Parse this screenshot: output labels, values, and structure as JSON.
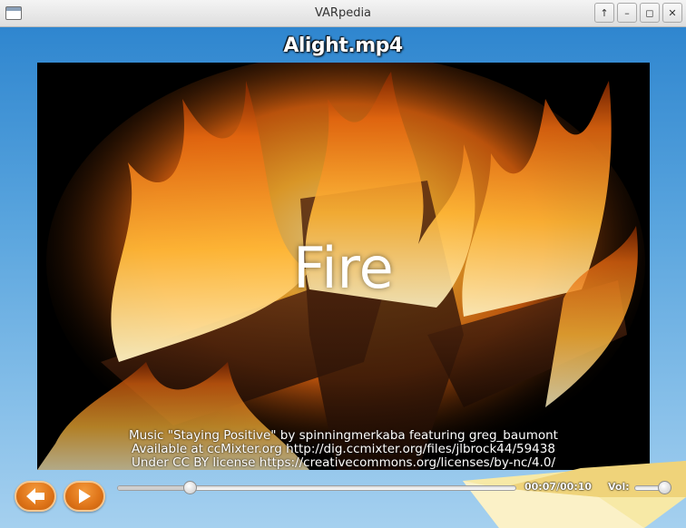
{
  "window": {
    "title": "VARpedia",
    "controls": [
      {
        "name": "maximize-icon",
        "glyph": "↑"
      },
      {
        "name": "minimize-icon",
        "glyph": "–"
      },
      {
        "name": "restore-icon",
        "glyph": "◻"
      },
      {
        "name": "close-icon",
        "glyph": "✕"
      }
    ]
  },
  "player": {
    "file_title": "Alight.mp4",
    "video_word": "Fire",
    "credits": [
      "Music \"Staying Positive\" by spinningmerkaba featuring greg_baumont",
      "Available at ccMixter.org http://dig.ccmixter.org/files/jlbrock44/59438",
      "Under CC BY license https://creativecommons.org/licenses/by-nc/4.0/"
    ],
    "time_display": "00:07/00:10",
    "progress": 0.18,
    "volume_label": "Vol:",
    "volume": 0.85,
    "back_icon": "arrow-left-icon",
    "play_icon": "play-icon"
  },
  "colors": {
    "accent_button": "#e0761a",
    "background_blue": "#2f86cf",
    "fire_orange": "#ff9a1a"
  }
}
